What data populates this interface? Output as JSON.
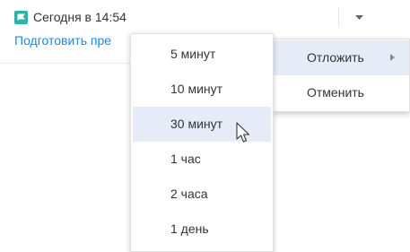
{
  "reminder": {
    "time_label": "Сегодня в 14:54",
    "link_text": "Подготовить пре"
  },
  "colors": {
    "flag": "#2bb3a8",
    "link": "#1e88e5",
    "highlight": "#e5ecf8"
  },
  "icons": {
    "flag": "flag-icon",
    "dropdown": "caret-down-icon",
    "submenu_arrow": "chevron-right-icon",
    "cursor": "mouse-pointer-icon"
  },
  "main_menu": {
    "items": [
      {
        "label": "Отложить",
        "has_submenu": true,
        "active": true
      },
      {
        "label": "Отменить",
        "has_submenu": false,
        "active": false
      }
    ]
  },
  "snooze_menu": {
    "items": [
      {
        "label": "5 минут"
      },
      {
        "label": "10 минут"
      },
      {
        "label": "30 минут",
        "highlighted": true
      },
      {
        "label": "1 час"
      },
      {
        "label": "2 часа"
      },
      {
        "label": "1 день"
      }
    ]
  }
}
